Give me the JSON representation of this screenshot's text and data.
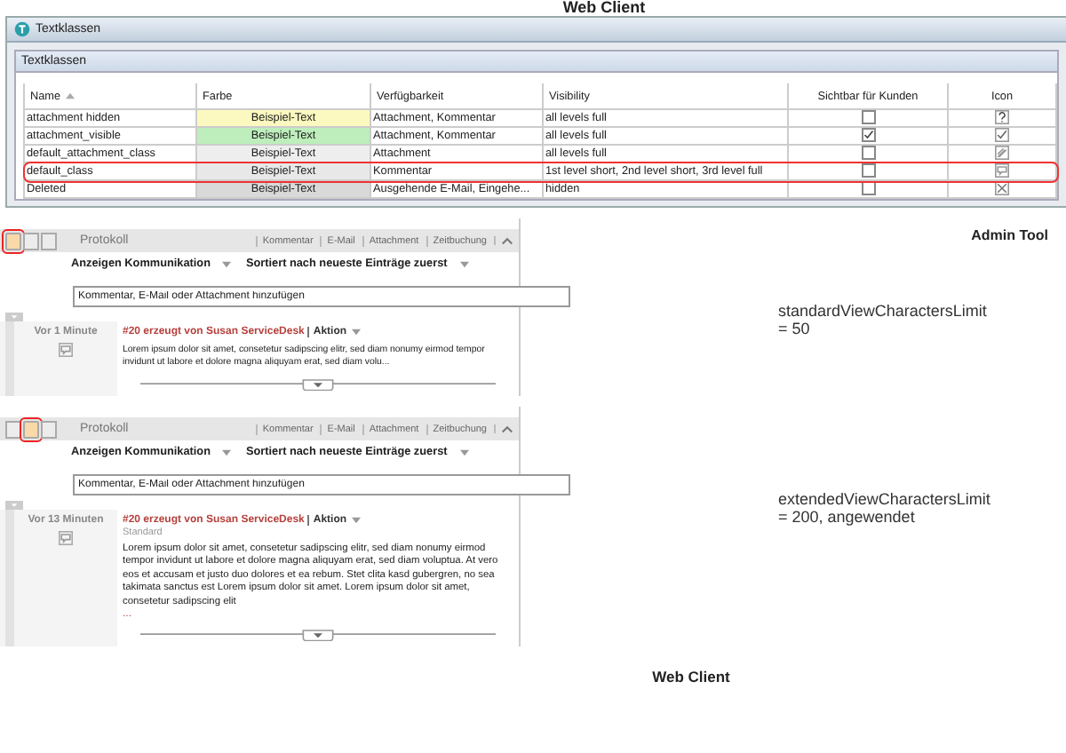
{
  "top_caption": "Web Client",
  "window": {
    "title": "Textklassen",
    "panel_title": "Textklassen"
  },
  "table": {
    "columns": [
      {
        "label": "Name",
        "sorted": true
      },
      {
        "label": "Farbe",
        "sorted": false
      },
      {
        "label": "Verfügbarkeit",
        "sorted": false
      },
      {
        "label": "Visibility",
        "sorted": false
      },
      {
        "label": "Sichtbar für Kunden",
        "sorted": false
      },
      {
        "label": "Icon",
        "sorted": false
      }
    ],
    "rows": [
      {
        "name": "attachment hidden",
        "farbe": "Beispiel-Text",
        "color": "#fbf9bf",
        "verfuegbarkeit": "Attachment, Kommentar",
        "visibility": "all levels full",
        "checked": false,
        "highlighted": false
      },
      {
        "name": "attachment_visible",
        "farbe": "Beispiel-Text",
        "color": "#bdeebb",
        "verfuegbarkeit": "Attachment, Kommentar",
        "visibility": "all levels full",
        "checked": true,
        "highlighted": false
      },
      {
        "name": "default_attachment_class",
        "farbe": "Beispiel-Text",
        "color": "#eeeeee",
        "verfuegbarkeit": "Attachment",
        "visibility": "all levels full",
        "checked": false,
        "highlighted": false
      },
      {
        "name": "default_class",
        "farbe": "Beispiel-Text",
        "color": "#e8e8e8",
        "verfuegbarkeit": "Kommentar",
        "visibility": "1st level short, 2nd level short, 3rd level full",
        "checked": false,
        "highlighted": true
      },
      {
        "name": "Deleted",
        "farbe": "Beispiel-Text",
        "color": "#d9d9d9",
        "verfuegbarkeit": "Ausgehende E-Mail, Eingehe...",
        "visibility": "hidden",
        "checked": false,
        "highlighted": false
      }
    ]
  },
  "admin_label": "Admin Tool",
  "panels": [
    {
      "view_buttons": [
        {
          "selected": true
        },
        {
          "selected": false
        },
        {
          "selected": false
        }
      ],
      "title": "Protokoll",
      "links": [
        "Kommentar",
        "E-Mail",
        "Attachment",
        "Zeitbuchung"
      ],
      "filter": "Anzeigen Kommunikation",
      "sort": "Sortiert nach neueste Einträge zuerst",
      "input": "Kommentar, E-Mail oder Attachment hinzufügen",
      "time": "Vor 1 Minute",
      "entry_title": "#20 erzeugt von Susan ServiceDesk",
      "action": "Aktion",
      "body": "Lorem ipsum dolor sit amet, consetetur sadipscing elitr, sed diam nonumy eirmod tempor invidunt ut labore et dolore magna aliquyam erat, sed diam volu...",
      "note": "standardViewCharactersLimit\n= 50"
    },
    {
      "view_buttons": [
        {
          "selected": false
        },
        {
          "selected": true
        },
        {
          "selected": false
        }
      ],
      "title": "Protokoll",
      "links": [
        "Kommentar",
        "E-Mail",
        "Attachment",
        "Zeitbuchung"
      ],
      "filter": "Anzeigen Kommunikation",
      "sort": "Sortiert nach neueste Einträge zuerst",
      "input": "Kommentar, E-Mail oder Attachment hinzufügen",
      "time": "Vor 13 Minuten",
      "entry_title": "#20 erzeugt von Susan ServiceDesk",
      "action": "Aktion",
      "subtitle": "Standard",
      "body": "Lorem ipsum dolor sit amet, consetetur sadipscing elitr, sed diam nonumy eirmod tempor invidunt ut labore et dolore magna aliquyam erat, sed diam voluptua. At vero eos et accusam et justo duo dolores et ea rebum. Stet clita kasd gubergren, no sea takimata sanctus est Lorem ipsum dolor sit amet. Lorem ipsum dolor sit amet, consetetur sadipscing elit",
      "more": "...",
      "note": "extendedViewCharactersLimit\n= 200, angewendet"
    }
  ],
  "bottom_caption": "Web Client"
}
